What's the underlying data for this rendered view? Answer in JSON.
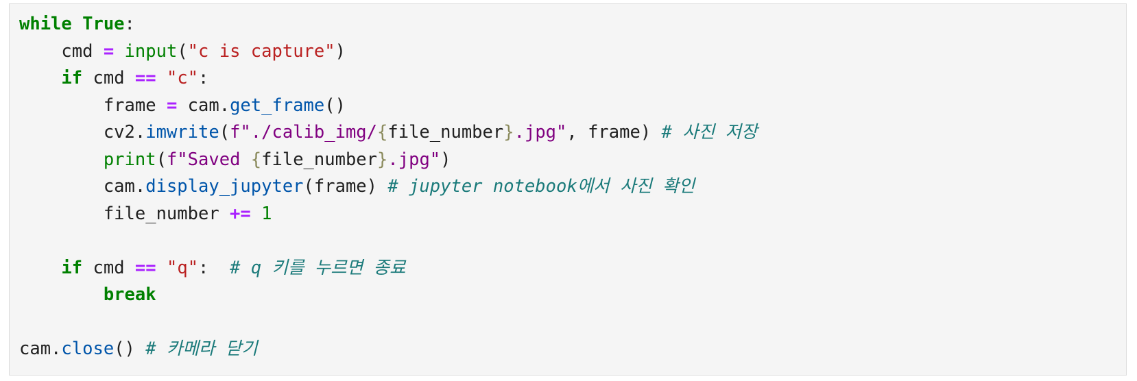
{
  "colors": {
    "background": "#f5f5f5",
    "border": "#dcdcdc",
    "keyword": "#008000",
    "operator": "#aa22ff",
    "string": "#ba2121",
    "fstring": "#800080",
    "function": "#0055aa",
    "builtin": "#008000",
    "number": "#008000",
    "brace": "#8a8a5c",
    "comment": "#1a7a7a",
    "text": "#212121"
  },
  "code_lines": [
    [
      [
        "kw",
        "while"
      ],
      [
        "tx",
        " "
      ],
      [
        "kw",
        "True"
      ],
      [
        "tx",
        ":"
      ]
    ],
    [
      [
        "tx",
        "    cmd "
      ],
      [
        "op",
        "="
      ],
      [
        "tx",
        " "
      ],
      [
        "bi",
        "input"
      ],
      [
        "tx",
        "("
      ],
      [
        "str",
        "\"c is capture\""
      ],
      [
        "tx",
        ")"
      ]
    ],
    [
      [
        "tx",
        "    "
      ],
      [
        "kw",
        "if"
      ],
      [
        "tx",
        " cmd "
      ],
      [
        "op",
        "=="
      ],
      [
        "tx",
        " "
      ],
      [
        "str",
        "\"c\""
      ],
      [
        "tx",
        ":"
      ]
    ],
    [
      [
        "tx",
        "        frame "
      ],
      [
        "op",
        "="
      ],
      [
        "tx",
        " cam."
      ],
      [
        "fn",
        "get_frame"
      ],
      [
        "tx",
        "()"
      ]
    ],
    [
      [
        "tx",
        "        cv2."
      ],
      [
        "fn",
        "imwrite"
      ],
      [
        "tx",
        "("
      ],
      [
        "fs",
        "f\"./calib_img/"
      ],
      [
        "brc",
        "{"
      ],
      [
        "tx",
        "file_number"
      ],
      [
        "brc",
        "}"
      ],
      [
        "fs",
        ".jpg\""
      ],
      [
        "tx",
        ", frame) "
      ],
      [
        "cm",
        "# 사진 저장"
      ]
    ],
    [
      [
        "tx",
        "        "
      ],
      [
        "bi",
        "print"
      ],
      [
        "tx",
        "("
      ],
      [
        "fs",
        "f\"Saved "
      ],
      [
        "brc",
        "{"
      ],
      [
        "tx",
        "file_number"
      ],
      [
        "brc",
        "}"
      ],
      [
        "fs",
        ".jpg\""
      ],
      [
        "tx",
        ")"
      ]
    ],
    [
      [
        "tx",
        "        cam."
      ],
      [
        "fn",
        "display_jupyter"
      ],
      [
        "tx",
        "(frame) "
      ],
      [
        "cm",
        "# jupyter notebook에서 사진 확인"
      ]
    ],
    [
      [
        "tx",
        "        file_number "
      ],
      [
        "op",
        "+="
      ],
      [
        "tx",
        " "
      ],
      [
        "num",
        "1"
      ]
    ],
    [],
    [
      [
        "tx",
        "    "
      ],
      [
        "kw",
        "if"
      ],
      [
        "tx",
        " cmd "
      ],
      [
        "op",
        "=="
      ],
      [
        "tx",
        " "
      ],
      [
        "str",
        "\"q\""
      ],
      [
        "tx",
        ":  "
      ],
      [
        "cm",
        "# q 키를 누르면 종료"
      ]
    ],
    [
      [
        "tx",
        "        "
      ],
      [
        "kw",
        "break"
      ]
    ],
    [],
    [
      [
        "tx",
        "cam."
      ],
      [
        "fn",
        "close"
      ],
      [
        "tx",
        "() "
      ],
      [
        "cm",
        "# 카메라 닫기"
      ]
    ]
  ]
}
